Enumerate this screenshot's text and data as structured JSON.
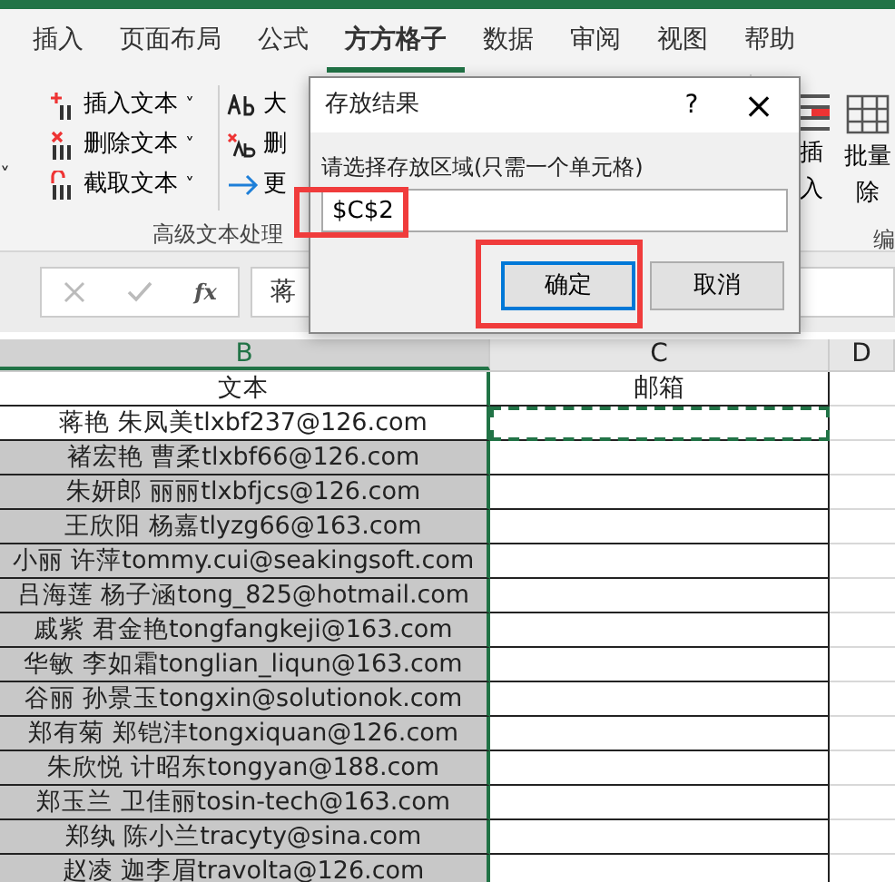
{
  "ribbon": {
    "tabs": [
      {
        "label": "插入",
        "selected": false
      },
      {
        "label": "页面布局",
        "selected": false
      },
      {
        "label": "公式",
        "selected": false
      },
      {
        "label": "方方格子",
        "selected": true
      },
      {
        "label": "数据",
        "selected": false
      },
      {
        "label": "审阅",
        "selected": false
      },
      {
        "label": "视图",
        "selected": false
      },
      {
        "label": "帮助",
        "selected": false
      }
    ],
    "left_caret": "˅",
    "text_group": {
      "items": [
        {
          "label": "插入文本",
          "caret": "˅"
        },
        {
          "label": "删除文本",
          "caret": "˅"
        },
        {
          "label": "截取文本",
          "caret": "˅"
        }
      ],
      "items_2": [
        {
          "label": "大",
          "kind": "ab"
        },
        {
          "label": "删",
          "kind": "delete"
        },
        {
          "label": "更",
          "kind": "arrow"
        }
      ],
      "label": "高级文本处理"
    },
    "edit_group": {
      "buttons": [
        {
          "lines": [
            "插",
            "入"
          ]
        },
        {
          "lines": [
            "批量",
            "除"
          ]
        }
      ],
      "label": "编"
    }
  },
  "formula_bar": {
    "fx_label": "fx",
    "value": "蒋"
  },
  "sheet": {
    "columns": [
      {
        "label": "B",
        "selected": true
      },
      {
        "label": "C",
        "selected": false
      },
      {
        "label": "D",
        "selected": false
      }
    ],
    "rows": [
      {
        "text": "文本",
        "email_cell": "邮箱",
        "shaded": false,
        "marked": false
      },
      {
        "text": "蒋艳 朱凤美tlxbf237@126.com",
        "shaded": false,
        "marked": true
      },
      {
        "text": "褚宏艳 曹柔tlxbf66@126.com",
        "shaded": true,
        "marked": false
      },
      {
        "text": "朱妍郎 丽丽tlxbfjcs@126.com",
        "shaded": true,
        "marked": false
      },
      {
        "text": "王欣阳 杨嘉tlyzg66@163.com",
        "shaded": true,
        "marked": false
      },
      {
        "text": "小丽 许萍tommy.cui@seakingsoft.com",
        "shaded": true,
        "marked": false
      },
      {
        "text": "吕海莲 杨子涵tong_825@hotmail.com",
        "shaded": true,
        "marked": false
      },
      {
        "text": "戚紫 君金艳tongfangkeji@163.com",
        "shaded": true,
        "marked": false
      },
      {
        "text": "华敏 李如霜tonglian_liqun@163.com",
        "shaded": true,
        "marked": false
      },
      {
        "text": "谷丽 孙景玉tongxin@solutionok.com",
        "shaded": true,
        "marked": false
      },
      {
        "text": "郑有菊 郑铠沣tongxiquan@126.com",
        "shaded": true,
        "marked": false
      },
      {
        "text": "朱欣悦 计昭东tongyan@188.com",
        "shaded": true,
        "marked": false
      },
      {
        "text": "郑玉兰 卫佳丽tosin-tech@163.com",
        "shaded": true,
        "marked": false
      },
      {
        "text": "郑纨 陈小兰tracyty@sina.com",
        "shaded": true,
        "marked": false
      },
      {
        "text": "赵凌 迦李眉travolta@126.com",
        "shaded": true,
        "marked": false
      }
    ]
  },
  "dialog": {
    "title": "存放结果",
    "help": "?",
    "close": "×",
    "prompt": "请选择存放区域(只需一个单元格)",
    "value": "$C$2",
    "buttons": [
      {
        "label": "确定",
        "default": true,
        "highlighted": true
      },
      {
        "label": "取消",
        "default": false,
        "highlighted": false
      }
    ],
    "field_highlighted": true
  }
}
